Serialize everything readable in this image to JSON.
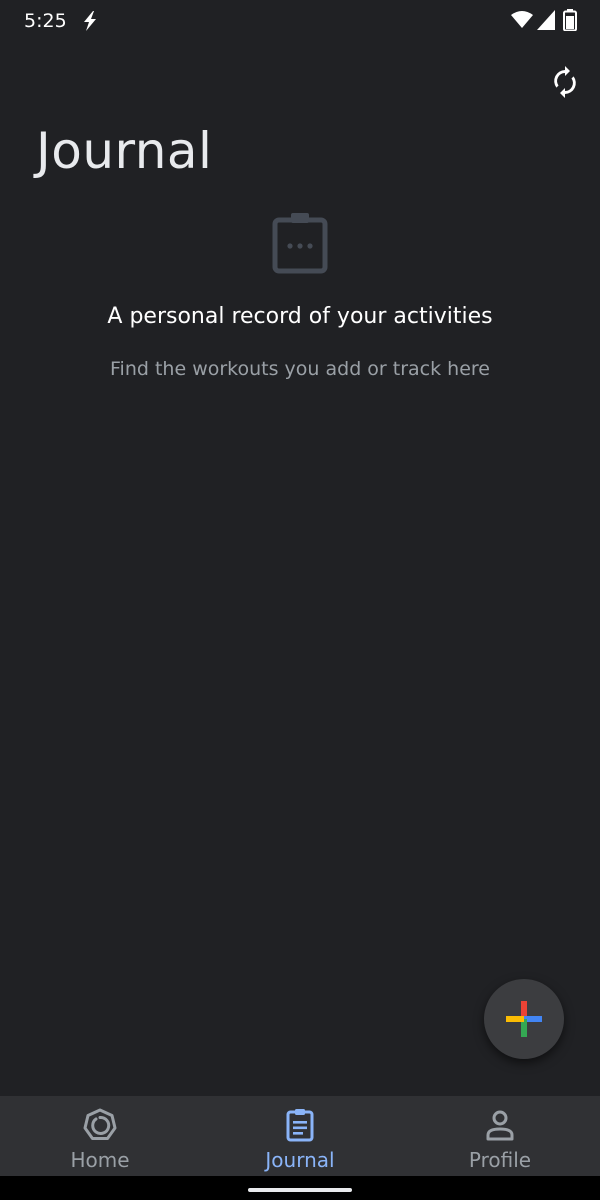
{
  "status_bar": {
    "time": "5:25",
    "icons": [
      "bolt-icon",
      "wifi-icon",
      "signal-icon",
      "battery-icon"
    ]
  },
  "header": {
    "title": "Journal",
    "sync_icon": "sync-icon"
  },
  "empty_state": {
    "icon": "clipboard-icon",
    "title": "A personal record of your activities",
    "subtitle": "Find the workouts you add or track here"
  },
  "fab": {
    "icon": "plus-icon",
    "colors": {
      "top": "#ea4335",
      "right": "#4285f4",
      "bottom": "#34a853",
      "left": "#fbbc04"
    }
  },
  "bottom_nav": {
    "items": [
      {
        "label": "Home",
        "icon": "home-icon",
        "active": false
      },
      {
        "label": "Journal",
        "icon": "journal-icon",
        "active": true
      },
      {
        "label": "Profile",
        "icon": "profile-icon",
        "active": false
      }
    ]
  },
  "colors": {
    "background": "#202124",
    "nav_background": "#303134",
    "accent": "#8ab4f8",
    "muted": "#9aa0a6"
  }
}
